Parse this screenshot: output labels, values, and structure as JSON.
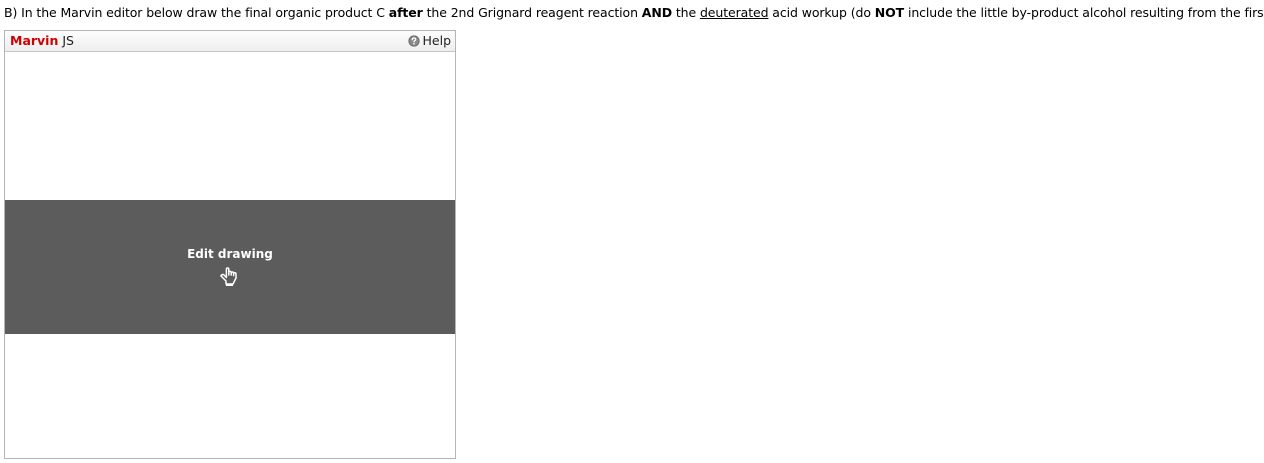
{
  "question": {
    "prefix": "B) In the Marvin editor below draw the final organic product C ",
    "bold1": "after",
    "mid1": " the 2nd Grignard reagent reaction ",
    "bold2": "AND",
    "mid2": " the ",
    "underlined": "deuterated",
    "mid3": " acid workup (do ",
    "bold3": "NOT",
    "suffix": " include the little by-product alcohol resulting from the first \"hit\")."
  },
  "editor": {
    "brand_name": "Marvin",
    "brand_suffix": " JS",
    "help_label": "Help",
    "edit_label": "Edit drawing",
    "colors": {
      "brand": "#d10000",
      "overlay": "#5c5c5c"
    },
    "icons": {
      "help": "help-circle-icon",
      "edit": "hand-pointer-icon"
    }
  }
}
